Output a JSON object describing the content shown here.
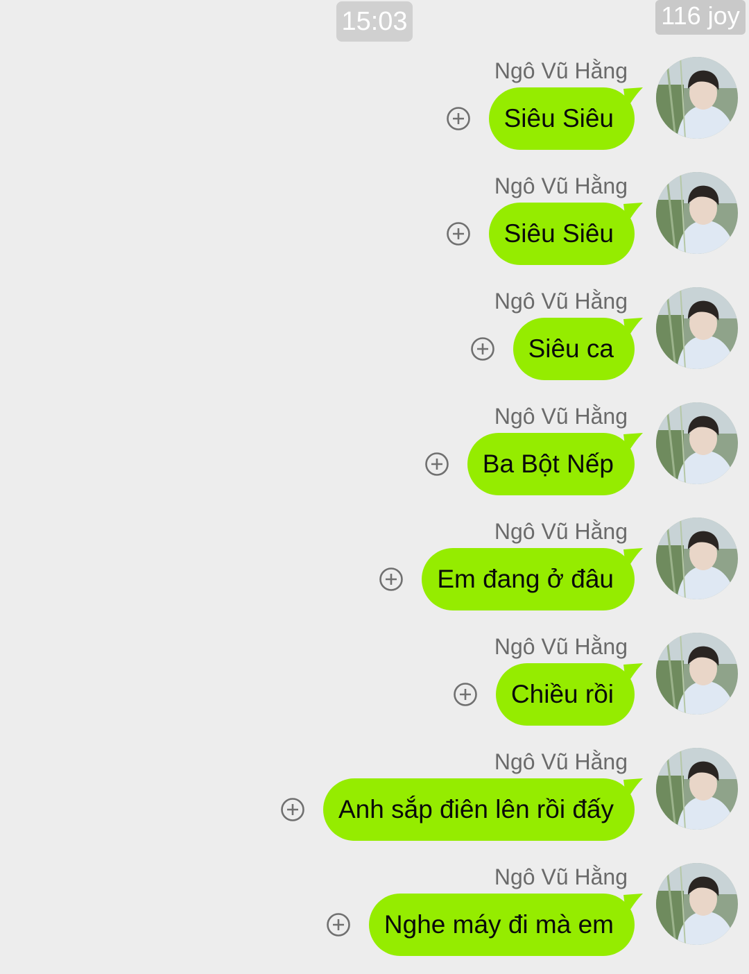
{
  "header": {
    "time": "15:03",
    "watermark": "116 joy"
  },
  "chat": {
    "messages": [
      {
        "sender": "Ngô Vũ Hằng",
        "text": "Siêu Siêu"
      },
      {
        "sender": "Ngô Vũ Hằng",
        "text": "Siêu Siêu"
      },
      {
        "sender": "Ngô Vũ Hằng",
        "text": "Siêu ca"
      },
      {
        "sender": "Ngô Vũ Hằng",
        "text": "Ba Bột Nếp"
      },
      {
        "sender": "Ngô Vũ Hằng",
        "text": "Em đang ở đâu"
      },
      {
        "sender": "Ngô Vũ Hằng",
        "text": "Chiều rồi"
      },
      {
        "sender": "Ngô Vũ Hằng",
        "text": "Anh sắp điên lên rồi đấy"
      },
      {
        "sender": "Ngô Vũ Hằng",
        "text": "Nghe máy đi mà em"
      }
    ]
  },
  "icons": {
    "add": "plus-circle-icon",
    "avatar": "profile-photo"
  },
  "colors": {
    "background": "#ededed",
    "bubble": "#95ec00",
    "sender_text": "#6a6a6a",
    "time_pill": "#d0d0d0"
  }
}
